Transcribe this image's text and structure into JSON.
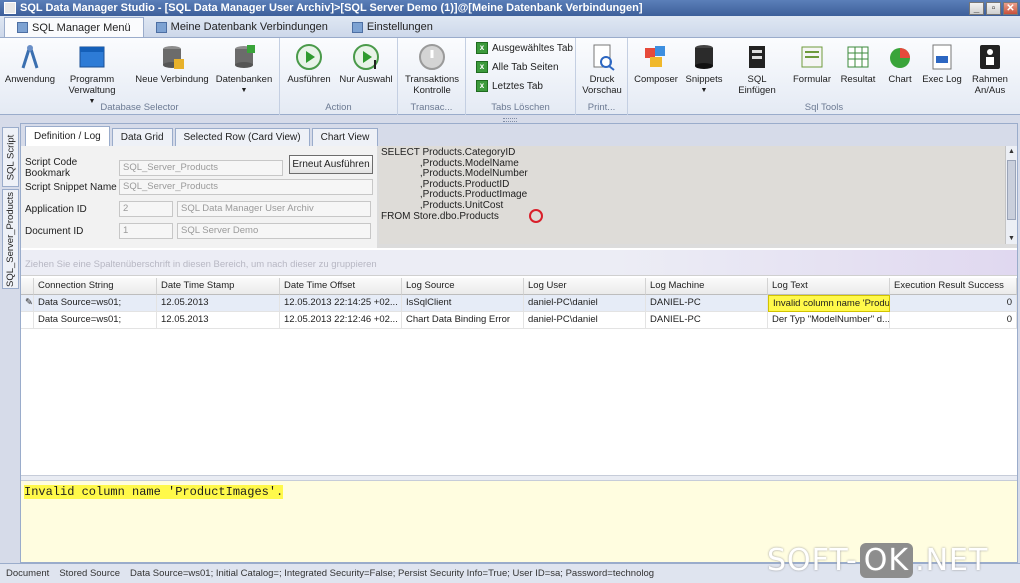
{
  "window": {
    "title": "SQL Data Manager Studio - [SQL Data Manager User Archiv]>[SQL Server Demo (1)]@[Meine Datenbank Verbindungen]",
    "buttons": {
      "minimize": "_",
      "restore": "▫",
      "close": "✕"
    }
  },
  "ribbon_tabs": [
    {
      "label": "SQL Manager Menü",
      "active": true
    },
    {
      "label": "Meine Datenbank Verbindungen",
      "active": false
    },
    {
      "label": "Einstellungen",
      "active": false
    }
  ],
  "ribbon": {
    "groups": {
      "database_selector": "Database Selector",
      "action": "Action",
      "transac": "Transac...",
      "tabs_loeschen": "Tabs Löschen",
      "print": "Print...",
      "sql_tools": "Sql Tools"
    },
    "buttons": {
      "anwendung": "Anwendung",
      "programm_verwaltung": "Programm Verwaltung",
      "neue_verbindung": "Neue Verbindung",
      "datenbanken": "Datenbanken",
      "ausfuehren": "Ausführen",
      "nur_auswahl": "Nur Auswahl",
      "transaktions_kontrolle": "Transaktions Kontrolle",
      "ausgewaehltes_tab": "Ausgewähltes Tab",
      "alle_tab_seiten": "Alle Tab Seiten",
      "letztes_tab": "Letztes Tab",
      "druck_vorschau": "Druck Vorschau",
      "composer": "Composer",
      "snippets": "Snippets",
      "sql_einfuegen": "SQL Einfügen",
      "formular": "Formular",
      "resultat": "Resultat",
      "chart": "Chart",
      "exec_log": "Exec Log",
      "rahmen_an_aus": "Rahmen An/Aus"
    }
  },
  "side_tabs": [
    "SQL Script",
    "SQL_Server_Products"
  ],
  "doc_tabs": [
    {
      "label": "Definition / Log",
      "active": true
    },
    {
      "label": "Data Grid",
      "active": false
    },
    {
      "label": "Selected Row (Card View)",
      "active": false
    },
    {
      "label": "Chart View",
      "active": false
    }
  ],
  "form": {
    "script_bookmark_label": "Script Code Bookmark",
    "script_bookmark_value": "SQL_Server_Products",
    "script_snippet_label": "Script Snippet Name",
    "script_snippet_value": "SQL_Server_Products",
    "application_id_label": "Application ID",
    "application_id_value": "2",
    "application_name": "SQL Data Manager User Archiv",
    "document_id_label": "Document ID",
    "document_id_value": "1",
    "document_name": "SQL Server Demo",
    "rerun_button": "Erneut Ausführen"
  },
  "sql_text": "SELECT Products.CategoryID\n              ,Products.ModelName\n              ,Products.ModelNumber\n              ,Products.ProductID\n              ,Products.ProductImage\n              ,Products.UnitCost\nFROM Store.dbo.Products",
  "group_hint": "Ziehen Sie eine Spaltenüberschrift in diesen Bereich, um nach dieser zu gruppieren",
  "grid": {
    "columns": [
      "Connection String",
      "Date Time Stamp",
      "Date Time Offset",
      "Log Source",
      "Log User",
      "Log Machine",
      "Log Text",
      "Execution Result Success"
    ],
    "rows": [
      [
        "Data Source=ws01;",
        "12.05.2013",
        "12.05.2013 22:14:25 +02...",
        "IsSqlClient",
        "daniel-PC\\daniel",
        "DANIEL-PC",
        "Invalid column name 'Product",
        "0"
      ],
      [
        "Data Source=ws01;",
        "12.05.2013",
        "12.05.2013 22:12:46 +02...",
        "Chart Data Binding Error",
        "daniel-PC\\daniel",
        "DANIEL-PC",
        "Der Typ \"ModelNumber\" d...",
        "0"
      ]
    ]
  },
  "message": "Invalid column name 'ProductImages'.",
  "status": {
    "document": "Document",
    "stored_source": "Stored Source",
    "connection": "Data Source=ws01; Initial Catalog=; Integrated Security=False; Persist Security Info=True; User ID=sa; Password=technolog"
  },
  "watermark": {
    "left": "SOFT-",
    "ok": "OK",
    "right": ".NET"
  },
  "colors": {
    "highlight": "#fff94a",
    "accent": "#3d5f9a",
    "error_circle": "#d91f2a"
  }
}
